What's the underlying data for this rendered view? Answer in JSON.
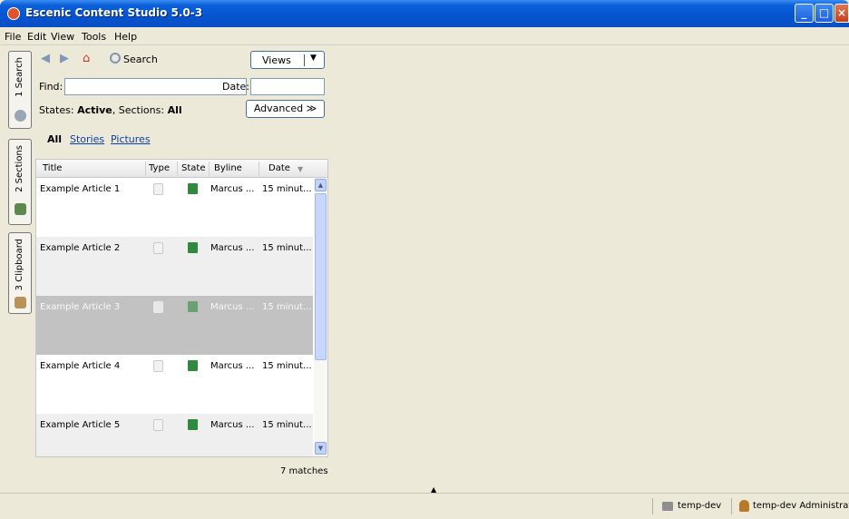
{
  "window": {
    "title": "Escenic Content Studio 5.0-3"
  },
  "menu": [
    "File",
    "Edit",
    "View",
    "Tools",
    "Help"
  ],
  "side_tabs": [
    "1 Search",
    "2 Sections",
    "3 Clipboard"
  ],
  "toolbar": {
    "search_label": "Search",
    "views_label": "Views"
  },
  "search": {
    "find_label": "Find:",
    "find_value": "",
    "date_label": "Date:",
    "date_value": "",
    "states_prefix": "States: ",
    "states_value": "Active",
    "sections_prefix": ", Sections: ",
    "sections_value": "All",
    "advanced_label": "Advanced ≫"
  },
  "filters": [
    "All",
    "Stories",
    "Pictures"
  ],
  "table": {
    "columns": [
      "Title",
      "Type",
      "State",
      "Byline",
      "Date"
    ],
    "rows": [
      {
        "title": "Example Article 1",
        "byline": "Marcus ...",
        "date": "15 minut..."
      },
      {
        "title": "Example Article 2",
        "byline": "Marcus ...",
        "date": "15 minut..."
      },
      {
        "title": "Example Article 3",
        "byline": "Marcus ...",
        "date": "15 minut..."
      },
      {
        "title": "Example Article 4",
        "byline": "Marcus ...",
        "date": "15 minut..."
      },
      {
        "title": "Example Article 5",
        "byline": "Marcus ...",
        "date": "15 minut..."
      }
    ],
    "selected_row": 3
  },
  "matches_label": "7 matches",
  "status": {
    "publication": "temp-dev",
    "user": "temp-dev Administrator"
  },
  "icons": {
    "back": "arrow-left-icon",
    "forward": "arrow-right-icon",
    "home": "home-icon",
    "search": "magnifier-icon",
    "type": "document-icon",
    "state": "state-published-icon",
    "folder": "folder-icon",
    "user": "user-icon"
  },
  "colors": {
    "titlebar": "#0554d0",
    "link": "#0b3fa6",
    "state_green": "#2e8b3d",
    "selected_row": "#c2c2c2"
  }
}
